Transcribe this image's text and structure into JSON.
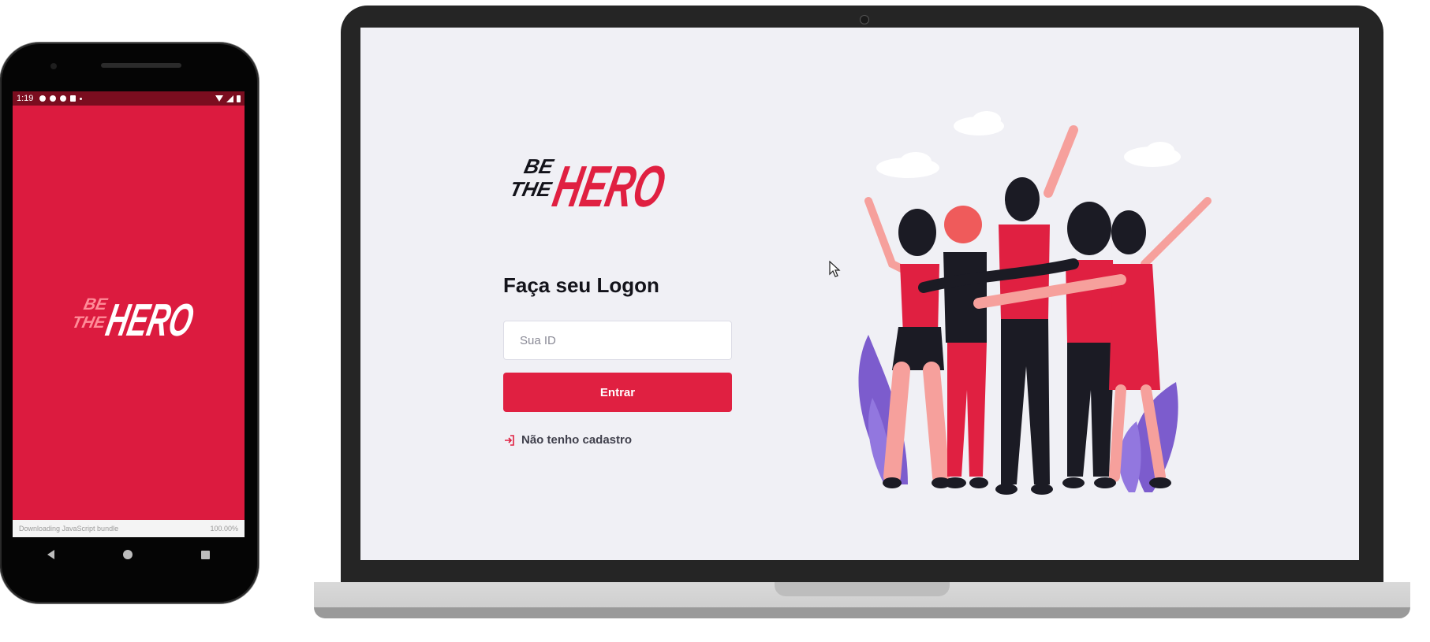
{
  "phone": {
    "status_time": "1:19",
    "bundle_text": "Downloading JavaScript bundle",
    "bundle_progress": "100.00%",
    "logo": {
      "be": "BE",
      "the": "THE",
      "hero": "HERO"
    }
  },
  "login": {
    "logo": {
      "be": "BE",
      "the": "THE",
      "hero": "HERO"
    },
    "title": "Faça seu Logon",
    "id_placeholder": "Sua ID",
    "submit_label": "Entrar",
    "register_link": "Não tenho cadastro"
  },
  "colors": {
    "brand_red": "#e02041",
    "background": "#f0f0f5",
    "text_dark": "#13131a"
  },
  "icons": [
    "log-in-icon",
    "mouse-cursor-icon",
    "back-icon",
    "home-icon",
    "recents-icon"
  ]
}
